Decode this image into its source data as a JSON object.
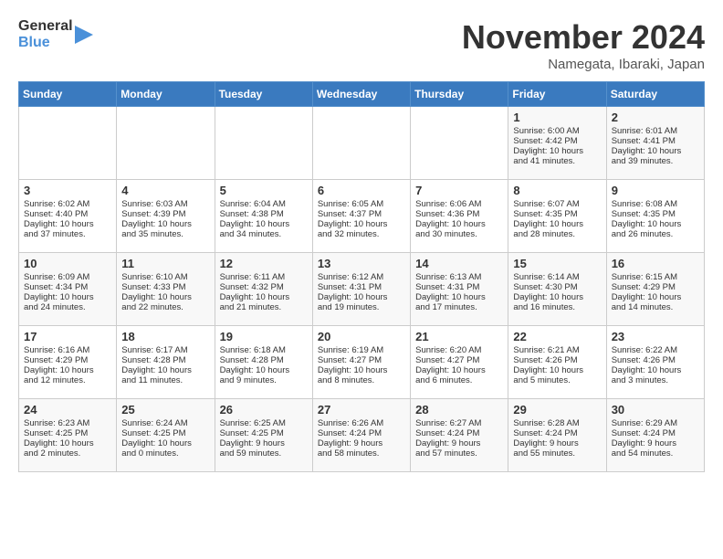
{
  "header": {
    "logo_line1": "General",
    "logo_line2": "Blue",
    "month": "November 2024",
    "location": "Namegata, Ibaraki, Japan"
  },
  "weekdays": [
    "Sunday",
    "Monday",
    "Tuesday",
    "Wednesday",
    "Thursday",
    "Friday",
    "Saturday"
  ],
  "weeks": [
    [
      {
        "day": "",
        "info": ""
      },
      {
        "day": "",
        "info": ""
      },
      {
        "day": "",
        "info": ""
      },
      {
        "day": "",
        "info": ""
      },
      {
        "day": "",
        "info": ""
      },
      {
        "day": "1",
        "info": "Sunrise: 6:00 AM\nSunset: 4:42 PM\nDaylight: 10 hours\nand 41 minutes."
      },
      {
        "day": "2",
        "info": "Sunrise: 6:01 AM\nSunset: 4:41 PM\nDaylight: 10 hours\nand 39 minutes."
      }
    ],
    [
      {
        "day": "3",
        "info": "Sunrise: 6:02 AM\nSunset: 4:40 PM\nDaylight: 10 hours\nand 37 minutes."
      },
      {
        "day": "4",
        "info": "Sunrise: 6:03 AM\nSunset: 4:39 PM\nDaylight: 10 hours\nand 35 minutes."
      },
      {
        "day": "5",
        "info": "Sunrise: 6:04 AM\nSunset: 4:38 PM\nDaylight: 10 hours\nand 34 minutes."
      },
      {
        "day": "6",
        "info": "Sunrise: 6:05 AM\nSunset: 4:37 PM\nDaylight: 10 hours\nand 32 minutes."
      },
      {
        "day": "7",
        "info": "Sunrise: 6:06 AM\nSunset: 4:36 PM\nDaylight: 10 hours\nand 30 minutes."
      },
      {
        "day": "8",
        "info": "Sunrise: 6:07 AM\nSunset: 4:35 PM\nDaylight: 10 hours\nand 28 minutes."
      },
      {
        "day": "9",
        "info": "Sunrise: 6:08 AM\nSunset: 4:35 PM\nDaylight: 10 hours\nand 26 minutes."
      }
    ],
    [
      {
        "day": "10",
        "info": "Sunrise: 6:09 AM\nSunset: 4:34 PM\nDaylight: 10 hours\nand 24 minutes."
      },
      {
        "day": "11",
        "info": "Sunrise: 6:10 AM\nSunset: 4:33 PM\nDaylight: 10 hours\nand 22 minutes."
      },
      {
        "day": "12",
        "info": "Sunrise: 6:11 AM\nSunset: 4:32 PM\nDaylight: 10 hours\nand 21 minutes."
      },
      {
        "day": "13",
        "info": "Sunrise: 6:12 AM\nSunset: 4:31 PM\nDaylight: 10 hours\nand 19 minutes."
      },
      {
        "day": "14",
        "info": "Sunrise: 6:13 AM\nSunset: 4:31 PM\nDaylight: 10 hours\nand 17 minutes."
      },
      {
        "day": "15",
        "info": "Sunrise: 6:14 AM\nSunset: 4:30 PM\nDaylight: 10 hours\nand 16 minutes."
      },
      {
        "day": "16",
        "info": "Sunrise: 6:15 AM\nSunset: 4:29 PM\nDaylight: 10 hours\nand 14 minutes."
      }
    ],
    [
      {
        "day": "17",
        "info": "Sunrise: 6:16 AM\nSunset: 4:29 PM\nDaylight: 10 hours\nand 12 minutes."
      },
      {
        "day": "18",
        "info": "Sunrise: 6:17 AM\nSunset: 4:28 PM\nDaylight: 10 hours\nand 11 minutes."
      },
      {
        "day": "19",
        "info": "Sunrise: 6:18 AM\nSunset: 4:28 PM\nDaylight: 10 hours\nand 9 minutes."
      },
      {
        "day": "20",
        "info": "Sunrise: 6:19 AM\nSunset: 4:27 PM\nDaylight: 10 hours\nand 8 minutes."
      },
      {
        "day": "21",
        "info": "Sunrise: 6:20 AM\nSunset: 4:27 PM\nDaylight: 10 hours\nand 6 minutes."
      },
      {
        "day": "22",
        "info": "Sunrise: 6:21 AM\nSunset: 4:26 PM\nDaylight: 10 hours\nand 5 minutes."
      },
      {
        "day": "23",
        "info": "Sunrise: 6:22 AM\nSunset: 4:26 PM\nDaylight: 10 hours\nand 3 minutes."
      }
    ],
    [
      {
        "day": "24",
        "info": "Sunrise: 6:23 AM\nSunset: 4:25 PM\nDaylight: 10 hours\nand 2 minutes."
      },
      {
        "day": "25",
        "info": "Sunrise: 6:24 AM\nSunset: 4:25 PM\nDaylight: 10 hours\nand 0 minutes."
      },
      {
        "day": "26",
        "info": "Sunrise: 6:25 AM\nSunset: 4:25 PM\nDaylight: 9 hours\nand 59 minutes."
      },
      {
        "day": "27",
        "info": "Sunrise: 6:26 AM\nSunset: 4:24 PM\nDaylight: 9 hours\nand 58 minutes."
      },
      {
        "day": "28",
        "info": "Sunrise: 6:27 AM\nSunset: 4:24 PM\nDaylight: 9 hours\nand 57 minutes."
      },
      {
        "day": "29",
        "info": "Sunrise: 6:28 AM\nSunset: 4:24 PM\nDaylight: 9 hours\nand 55 minutes."
      },
      {
        "day": "30",
        "info": "Sunrise: 6:29 AM\nSunset: 4:24 PM\nDaylight: 9 hours\nand 54 minutes."
      }
    ]
  ]
}
